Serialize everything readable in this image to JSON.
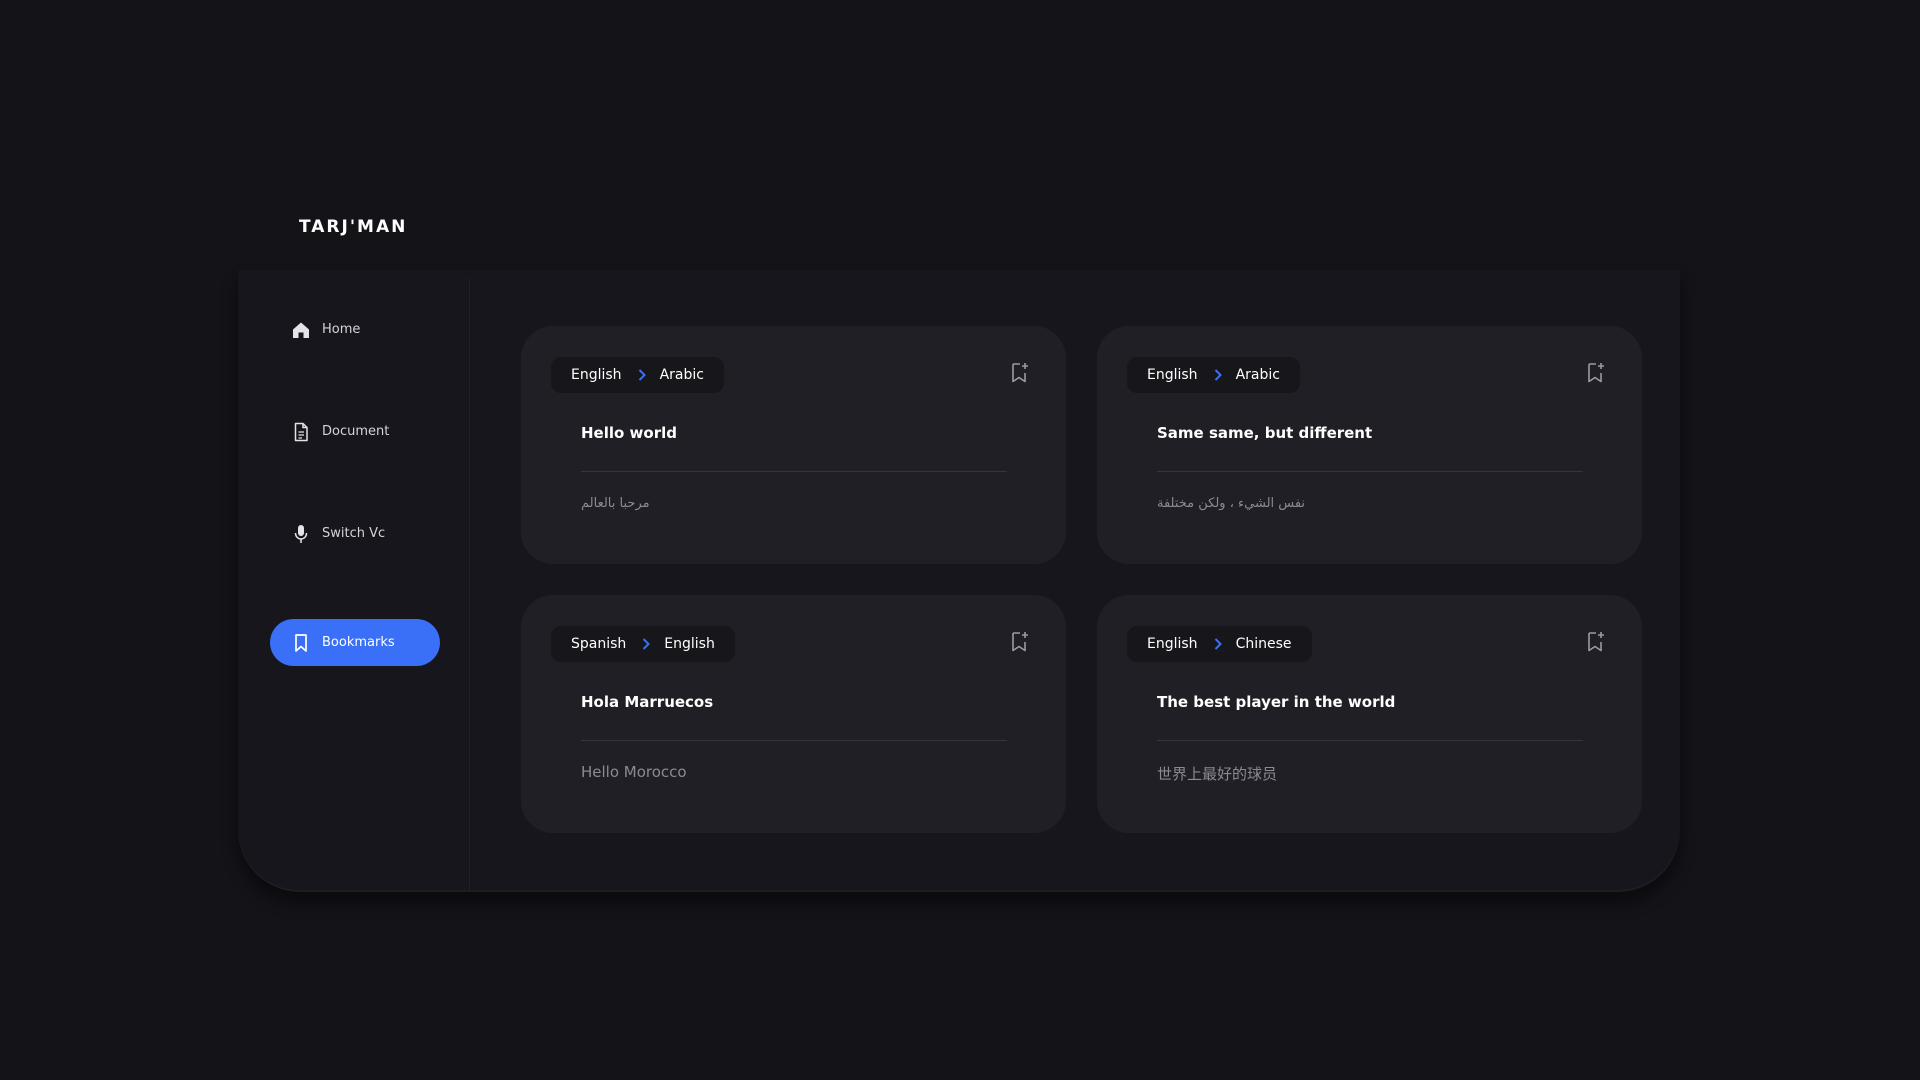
{
  "app": {
    "brand": "TARJ'MAN"
  },
  "sidebar": {
    "items": [
      {
        "label": "Home",
        "icon": "home-icon",
        "active": false
      },
      {
        "label": "Document",
        "icon": "document-icon",
        "active": false
      },
      {
        "label": "Switch Vc",
        "icon": "microphone-icon",
        "active": false
      },
      {
        "label": "Bookmarks",
        "icon": "bookmark-icon",
        "active": true
      }
    ]
  },
  "colors": {
    "background": "#131318",
    "panel": "#16161c",
    "card": "#1f1f25",
    "accent": "#3a6ff7",
    "muted_text": "#8a8a90"
  },
  "cards": [
    {
      "from": "English",
      "to": "Arabic",
      "source": "Hello world",
      "translation": "مرحبا بالعالم"
    },
    {
      "from": "English",
      "to": "Arabic",
      "source": "Same same, but different",
      "translation": "نفس الشيء ، ولكن مختلفة"
    },
    {
      "from": "Spanish",
      "to": "English",
      "source": "Hola Marruecos",
      "translation": "Hello Morocco"
    },
    {
      "from": "English",
      "to": "Chinese",
      "source": "The best player in the world",
      "translation": "世界上最好的球员"
    }
  ]
}
